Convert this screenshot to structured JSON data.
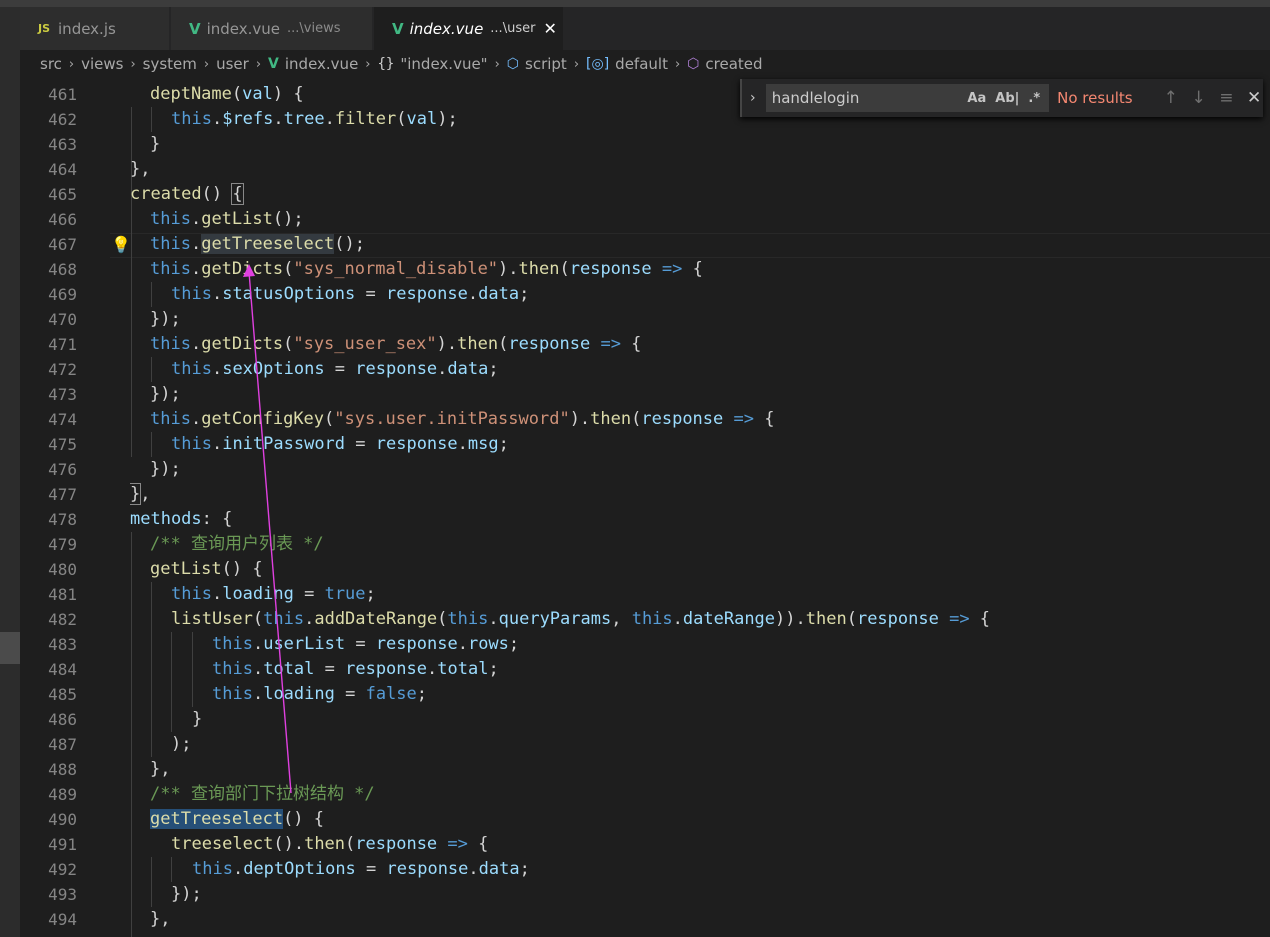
{
  "tabs": [
    {
      "label": "index.js",
      "badge": "JS",
      "active": false
    },
    {
      "label": "index.vue",
      "desc": "...\\views",
      "active": false
    },
    {
      "label": "index.vue",
      "desc": "...\\user",
      "active": true,
      "close": "✕"
    }
  ],
  "breadcrumb": {
    "items": [
      "src",
      "views",
      "system",
      "user",
      "index.vue",
      "\"index.vue\"",
      "script",
      "default",
      "created"
    ],
    "separator": "›"
  },
  "find": {
    "value": "handlelogin",
    "status": "No results",
    "options": [
      "Aa",
      "Ab|",
      ".*"
    ]
  },
  "line_numbers": [
    "461",
    "462",
    "463",
    "464",
    "465",
    "466",
    "467",
    "468",
    "469",
    "470",
    "471",
    "472",
    "473",
    "474",
    "475",
    "476",
    "477",
    "478",
    "479",
    "480",
    "481",
    "482",
    "483",
    "484",
    "485",
    "486",
    "487",
    "488",
    "489",
    "490",
    "491",
    "492",
    "493",
    "494"
  ],
  "code": {
    "l461": {
      "a": "deptName",
      "b": "(",
      "c": "val",
      "d": ") {"
    },
    "l462": {
      "a": "this",
      "b": ".",
      "c": "$refs",
      "d": ".",
      "e": "tree",
      "f": ".",
      "g": "filter",
      "h": "(",
      "i": "val",
      "j": ");"
    },
    "l463": "}",
    "l464": "},",
    "l465": {
      "a": "created",
      "b": "() ",
      "c": "{"
    },
    "l466": {
      "a": "this",
      "b": ".",
      "c": "getList",
      "d": "();"
    },
    "l467": {
      "a": "this",
      "b": ".",
      "c": "getTreeselect",
      "d": "();"
    },
    "l468": {
      "a": "this",
      "b": ".",
      "c": "getDicts",
      "d": "(",
      "e": "\"sys_normal_disable\"",
      "f": ").",
      "g": "then",
      "h": "(",
      "i": "response",
      "j": " => ",
      "k": "{"
    },
    "l469": {
      "a": "this",
      "b": ".",
      "c": "statusOptions",
      "d": " = ",
      "e": "response",
      "f": ".",
      "g": "data",
      "h": ";"
    },
    "l470": "});",
    "l471": {
      "a": "this",
      "b": ".",
      "c": "getDicts",
      "d": "(",
      "e": "\"sys_user_sex\"",
      "f": ").",
      "g": "then",
      "h": "(",
      "i": "response",
      "j": " => ",
      "k": "{"
    },
    "l472": {
      "a": "this",
      "b": ".",
      "c": "sexOptions",
      "d": " = ",
      "e": "response",
      "f": ".",
      "g": "data",
      "h": ";"
    },
    "l473": "});",
    "l474": {
      "a": "this",
      "b": ".",
      "c": "getConfigKey",
      "d": "(",
      "e": "\"sys.user.initPassword\"",
      "f": ").",
      "g": "then",
      "h": "(",
      "i": "response",
      "j": " => ",
      "k": "{"
    },
    "l475": {
      "a": "this",
      "b": ".",
      "c": "initPassword",
      "d": " = ",
      "e": "response",
      "f": ".",
      "g": "msg",
      "h": ";"
    },
    "l476": "});",
    "l477": {
      "a": "}",
      "b": ","
    },
    "l478": {
      "a": "methods",
      "b": ": {"
    },
    "l479": "/** 查询用户列表 */",
    "l480": {
      "a": "getList",
      "b": "() {"
    },
    "l481": {
      "a": "this",
      "b": ".",
      "c": "loading",
      "d": " = ",
      "e": "true",
      "f": ";"
    },
    "l482": {
      "a": "listUser",
      "b": "(",
      "c": "this",
      "d": ".",
      "e": "addDateRange",
      "f": "(",
      "g": "this",
      "h": ".",
      "i": "queryParams",
      "j": ", ",
      "k": "this",
      "l": ".",
      "m": "dateRange",
      "n": ")).",
      "o": "then",
      "p": "(",
      "q": "response",
      "r": " => ",
      "s": "{"
    },
    "l483": {
      "a": "this",
      "b": ".",
      "c": "userList",
      "d": " = ",
      "e": "response",
      "f": ".",
      "g": "rows",
      "h": ";"
    },
    "l484": {
      "a": "this",
      "b": ".",
      "c": "total",
      "d": " = ",
      "e": "response",
      "f": ".",
      "g": "total",
      "h": ";"
    },
    "l485": {
      "a": "this",
      "b": ".",
      "c": "loading",
      "d": " = ",
      "e": "false",
      "f": ";"
    },
    "l486": "}",
    "l487": ");",
    "l488": "},",
    "l489": "/** 查询部门下拉树结构 */",
    "l490": {
      "a": "getTreeselect",
      "b": "() {"
    },
    "l491": {
      "a": "treeselect",
      "b": "().",
      "c": "then",
      "d": "(",
      "e": "response",
      "f": " => ",
      "g": "{"
    },
    "l492": {
      "a": "this",
      "b": ".",
      "c": "deptOptions",
      "d": " = ",
      "e": "response",
      "f": ".",
      "g": "data",
      "h": ";"
    },
    "l493": "});",
    "l494": "},"
  },
  "colors": {
    "keyword": "#569cd6",
    "function": "#dcdcaa",
    "variable": "#9cdcfe",
    "string": "#ce9178",
    "comment": "#6a9955",
    "find_no_results": "#f48771",
    "annotation_arrow": "#e040e0"
  },
  "icons": [
    "js-icon",
    "vue-icon",
    "braces-icon",
    "cube-icon",
    "field-icon",
    "method-icon",
    "lightbulb-icon",
    "chevron-right-icon",
    "arrow-up-icon",
    "arrow-down-icon",
    "select-lines-icon",
    "close-icon"
  ]
}
